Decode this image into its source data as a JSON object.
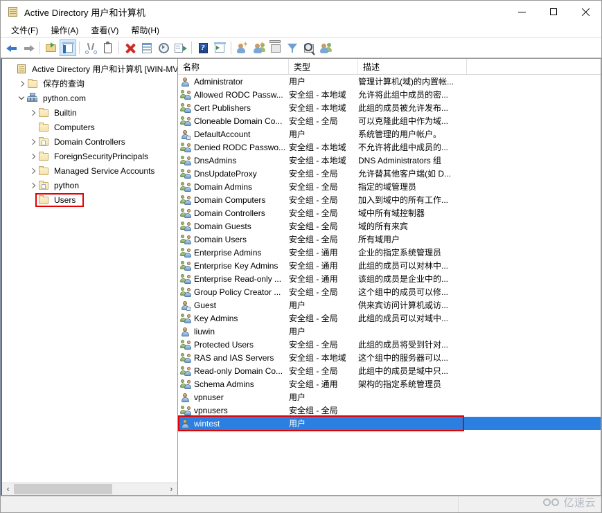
{
  "window": {
    "title": "Active Directory 用户和计算机",
    "icon": "console-book-icon",
    "buttons": {
      "minimize": "—",
      "maximize": "□",
      "close": "✕"
    }
  },
  "menubar": {
    "items": [
      {
        "label": "文件(F)",
        "name": "menu-file"
      },
      {
        "label": "操作(A)",
        "name": "menu-action"
      },
      {
        "label": "查看(V)",
        "name": "menu-view"
      },
      {
        "label": "帮助(H)",
        "name": "menu-help"
      }
    ]
  },
  "toolbar": {
    "items": [
      {
        "name": "back-icon"
      },
      {
        "name": "forward-icon"
      },
      {
        "name": "up-one-level-icon"
      },
      {
        "name": "show-hide-console-tree-icon"
      },
      {
        "name": "cut-icon"
      },
      {
        "name": "paste-icon"
      },
      {
        "name": "delete-icon"
      },
      {
        "name": "properties-icon"
      },
      {
        "name": "refresh-icon"
      },
      {
        "name": "export-list-icon"
      },
      {
        "name": "help-icon"
      },
      {
        "name": "show-hide-action-pane-icon"
      },
      {
        "name": "new-user-icon"
      },
      {
        "name": "new-group-icon"
      },
      {
        "name": "new-organizational-unit-icon"
      },
      {
        "name": "filter-icon"
      },
      {
        "name": "find-icon"
      },
      {
        "name": "add-to-group-icon"
      }
    ]
  },
  "tree": {
    "nodes": [
      {
        "label": "Active Directory 用户和计算机 [WIN-MV",
        "icon": "console-book-icon",
        "indent": 0,
        "twisty": "none",
        "name": "tree-node-root"
      },
      {
        "label": "保存的查询",
        "icon": "folder-icon",
        "indent": 1,
        "twisty": "collapsed",
        "name": "tree-node-saved-queries"
      },
      {
        "label": "python.com",
        "icon": "domain-icon",
        "indent": 1,
        "twisty": "expanded",
        "name": "tree-node-python-com"
      },
      {
        "label": "Builtin",
        "icon": "folder-icon",
        "indent": 2,
        "twisty": "collapsed",
        "name": "tree-node-builtin"
      },
      {
        "label": "Computers",
        "icon": "folder-icon",
        "indent": 2,
        "twisty": "none",
        "name": "tree-node-computers"
      },
      {
        "label": "Domain Controllers",
        "icon": "ou-folder-icon",
        "indent": 2,
        "twisty": "collapsed",
        "name": "tree-node-domain-controllers"
      },
      {
        "label": "ForeignSecurityPrincipals",
        "icon": "folder-icon",
        "indent": 2,
        "twisty": "collapsed",
        "name": "tree-node-foreign-security-principals"
      },
      {
        "label": "Managed Service Accounts",
        "icon": "folder-icon",
        "indent": 2,
        "twisty": "collapsed",
        "name": "tree-node-managed-service-accounts"
      },
      {
        "label": "python",
        "icon": "ou-folder-icon",
        "indent": 2,
        "twisty": "collapsed",
        "name": "tree-node-python"
      },
      {
        "label": "Users",
        "icon": "folder-icon",
        "indent": 2,
        "twisty": "none",
        "name": "tree-node-users",
        "highlighted": true
      }
    ],
    "highlight_color": "#e60000",
    "scrollbar": {
      "left_arrow": "‹",
      "right_arrow": "›"
    }
  },
  "list": {
    "columns": [
      {
        "label": "名称",
        "name": "column-header-name"
      },
      {
        "label": "类型",
        "name": "column-header-type"
      },
      {
        "label": "描述",
        "name": "column-header-description"
      }
    ],
    "rows": [
      {
        "name": "Administrator",
        "type": "用户",
        "description": "管理计算机(域)的内置帐...",
        "icon": "user-icon"
      },
      {
        "name": "Allowed RODC Passw...",
        "type": "安全组 - 本地域",
        "description": "允许将此组中成员的密...",
        "icon": "group-icon"
      },
      {
        "name": "Cert Publishers",
        "type": "安全组 - 本地域",
        "description": "此组的成员被允许发布...",
        "icon": "group-icon"
      },
      {
        "name": "Cloneable Domain Co...",
        "type": "安全组 - 全局",
        "description": "可以克隆此组中作为域...",
        "icon": "group-icon"
      },
      {
        "name": "DefaultAccount",
        "type": "用户",
        "description": "系统管理的用户帐户。",
        "icon": "user-badge-icon"
      },
      {
        "name": "Denied RODC Passwo...",
        "type": "安全组 - 本地域",
        "description": "不允许将此组中成员的...",
        "icon": "group-icon"
      },
      {
        "name": "DnsAdmins",
        "type": "安全组 - 本地域",
        "description": "DNS Administrators 组",
        "icon": "group-icon"
      },
      {
        "name": "DnsUpdateProxy",
        "type": "安全组 - 全局",
        "description": "允许替其他客户端(如 D...",
        "icon": "group-icon"
      },
      {
        "name": "Domain Admins",
        "type": "安全组 - 全局",
        "description": "指定的域管理员",
        "icon": "group-icon"
      },
      {
        "name": "Domain Computers",
        "type": "安全组 - 全局",
        "description": "加入到域中的所有工作...",
        "icon": "group-icon"
      },
      {
        "name": "Domain Controllers",
        "type": "安全组 - 全局",
        "description": "域中所有域控制器",
        "icon": "group-icon"
      },
      {
        "name": "Domain Guests",
        "type": "安全组 - 全局",
        "description": "域的所有来宾",
        "icon": "group-icon"
      },
      {
        "name": "Domain Users",
        "type": "安全组 - 全局",
        "description": "所有域用户",
        "icon": "group-icon"
      },
      {
        "name": "Enterprise Admins",
        "type": "安全组 - 通用",
        "description": "企业的指定系统管理员",
        "icon": "group-icon"
      },
      {
        "name": "Enterprise Key Admins",
        "type": "安全组 - 通用",
        "description": "此组的成员可以对林中...",
        "icon": "group-icon"
      },
      {
        "name": "Enterprise Read-only ...",
        "type": "安全组 - 通用",
        "description": "该组的成员是企业中的...",
        "icon": "group-icon"
      },
      {
        "name": "Group Policy Creator ...",
        "type": "安全组 - 全局",
        "description": "这个组中的成员可以修...",
        "icon": "group-icon"
      },
      {
        "name": "Guest",
        "type": "用户",
        "description": "供来宾访问计算机或访...",
        "icon": "user-badge-icon"
      },
      {
        "name": "Key Admins",
        "type": "安全组 - 全局",
        "description": "此组的成员可以对域中...",
        "icon": "group-icon"
      },
      {
        "name": "liuwin",
        "type": "用户",
        "description": "",
        "icon": "user-icon"
      },
      {
        "name": "Protected Users",
        "type": "安全组 - 全局",
        "description": "此组的成员将受到针对...",
        "icon": "group-icon"
      },
      {
        "name": "RAS and IAS Servers",
        "type": "安全组 - 本地域",
        "description": "这个组中的服务器可以...",
        "icon": "group-icon"
      },
      {
        "name": "Read-only Domain Co...",
        "type": "安全组 - 全局",
        "description": "此组中的成员是域中只...",
        "icon": "group-icon"
      },
      {
        "name": "Schema Admins",
        "type": "安全组 - 通用",
        "description": "架构的指定系统管理员",
        "icon": "group-icon"
      },
      {
        "name": "vpnuser",
        "type": "用户",
        "description": "",
        "icon": "user-icon"
      },
      {
        "name": "vpnusers",
        "type": "安全组 - 全局",
        "description": "",
        "icon": "group-icon"
      },
      {
        "name": "wintest",
        "type": "用户",
        "description": "",
        "icon": "user-icon",
        "selected": true,
        "highlighted": true
      }
    ],
    "selection_color": "#2a7fe0",
    "highlight_color": "#e60000"
  },
  "statusbar": {
    "text": ""
  },
  "watermark": {
    "text": "亿速云"
  }
}
